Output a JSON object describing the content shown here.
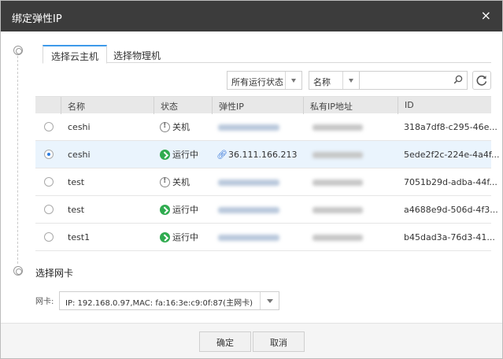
{
  "dialog": {
    "title": "绑定弹性IP",
    "close_icon": "×"
  },
  "tabs": [
    {
      "label": "选择云主机",
      "active": true
    },
    {
      "label": "选择物理机",
      "active": false
    }
  ],
  "filters": {
    "status_value": "所有运行状态",
    "field_value": "名称",
    "search_value": ""
  },
  "table": {
    "columns": [
      "名称",
      "状态",
      "弹性IP",
      "私有IP地址",
      "ID"
    ],
    "rows": [
      {
        "name": "ceshi",
        "status": "关机",
        "status_type": "stopped",
        "elastic_ip": "",
        "id": "318a7df8-c295-46e...",
        "selected": false
      },
      {
        "name": "ceshi",
        "status": "运行中",
        "status_type": "running",
        "elastic_ip": "36.111.166.213",
        "id": "5ede2f2c-224e-4a4f...",
        "selected": true
      },
      {
        "name": "test",
        "status": "关机",
        "status_type": "stopped",
        "elastic_ip": "",
        "id": "7051b29d-adba-44f...",
        "selected": false
      },
      {
        "name": "test",
        "status": "运行中",
        "status_type": "running",
        "elastic_ip": "",
        "id": "a4688e9d-506d-4f3...",
        "selected": false
      },
      {
        "name": "test1",
        "status": "运行中",
        "status_type": "running",
        "elastic_ip": "",
        "id": "b45dad3a-76d3-41...",
        "selected": false
      }
    ]
  },
  "nic": {
    "section_title": "选择网卡",
    "label": "网卡:",
    "value": "IP: 192.168.0.97,MAC: fa:16:3e:c9:0f:87(主网卡)"
  },
  "footer": {
    "ok_label": "确定",
    "cancel_label": "取消"
  },
  "colors": {
    "titlebar": "#3c3c3c",
    "accent": "#3d9aea",
    "running": "#2fab4f",
    "selected_row": "#eaf4fd",
    "link": "#2c6fd6"
  }
}
